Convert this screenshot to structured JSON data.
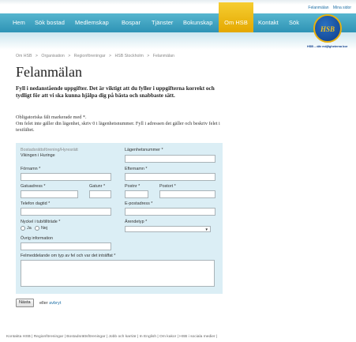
{
  "toplinks": [
    "Felanmälan",
    "Mina sidor"
  ],
  "nav": {
    "items": [
      {
        "label": "Hem",
        "active": false
      },
      {
        "label": "Sök bostad",
        "active": false
      },
      {
        "label": "Medlemskap",
        "active": false
      },
      {
        "label": "Bospar",
        "active": false
      },
      {
        "label": "Tjänster",
        "active": false
      },
      {
        "label": "Bokunskap",
        "active": false
      },
      {
        "label": "Om HSB",
        "active": true
      },
      {
        "label": "Kontakt",
        "active": false
      },
      {
        "label": "Sök",
        "active": false
      }
    ]
  },
  "logo": {
    "text": "HSB",
    "tagline": "HSB – där möjligheterna bor"
  },
  "breadcrumb": [
    "Om HSB",
    ">",
    "Organisation",
    ">",
    "Regionföreningar",
    ">",
    "HSB Stockholm",
    ">",
    "Felanmälan"
  ],
  "page": {
    "title": "Felanmälan",
    "intro": "Fyll i nedanstående uppgifter. Det är viktigt att du fyller i uppgifterna korrekt och tydligt för att vi ska kunna hjälpa dig på bästa och snabbaste sätt.",
    "note_line1": "Obligatoriska fält markerade med *.",
    "note_line2": "Om felet inte gäller din lägenhet, skriv 0 i lägenhetsnummer. Fyll i adressen det gäller och beskriv felet i textfältet."
  },
  "form": {
    "brf_label": "Bostadsrättsförening/Hyresrätt",
    "brf_value": "Vikingen i Huringe",
    "apartment_label": "Lägenhetsnummer *",
    "firstname_label": "Förnamn *",
    "lastname_label": "Efternamn *",
    "street_label": "Gatuadress *",
    "streetno_label": "Gatunr *",
    "zip_label": "Postnr *",
    "city_label": "Postort *",
    "phone_label": "Telefon dagtid *",
    "email_label": "E-postadress *",
    "key_label": "Nyckel i tub/tillträde *",
    "yes_label": "Ja",
    "no_label": "Nej",
    "errand_label": "Ärendetyp *",
    "other_label": "Övrig information",
    "desc_label": "Felmeddelande om typ av fel och var det inträffat *"
  },
  "actions": {
    "next_label": "Nästa",
    "or_text": "eller",
    "cancel_label": "avbryt"
  },
  "footer": [
    "Kontakta HSB",
    "|",
    "Regionföreningar",
    "|",
    "Bostadsrättsföreningar",
    "|",
    "Jobb och karriär",
    "|",
    "In English",
    "|",
    "Om kakor",
    "|",
    "HSB i sociala medier",
    "|"
  ]
}
